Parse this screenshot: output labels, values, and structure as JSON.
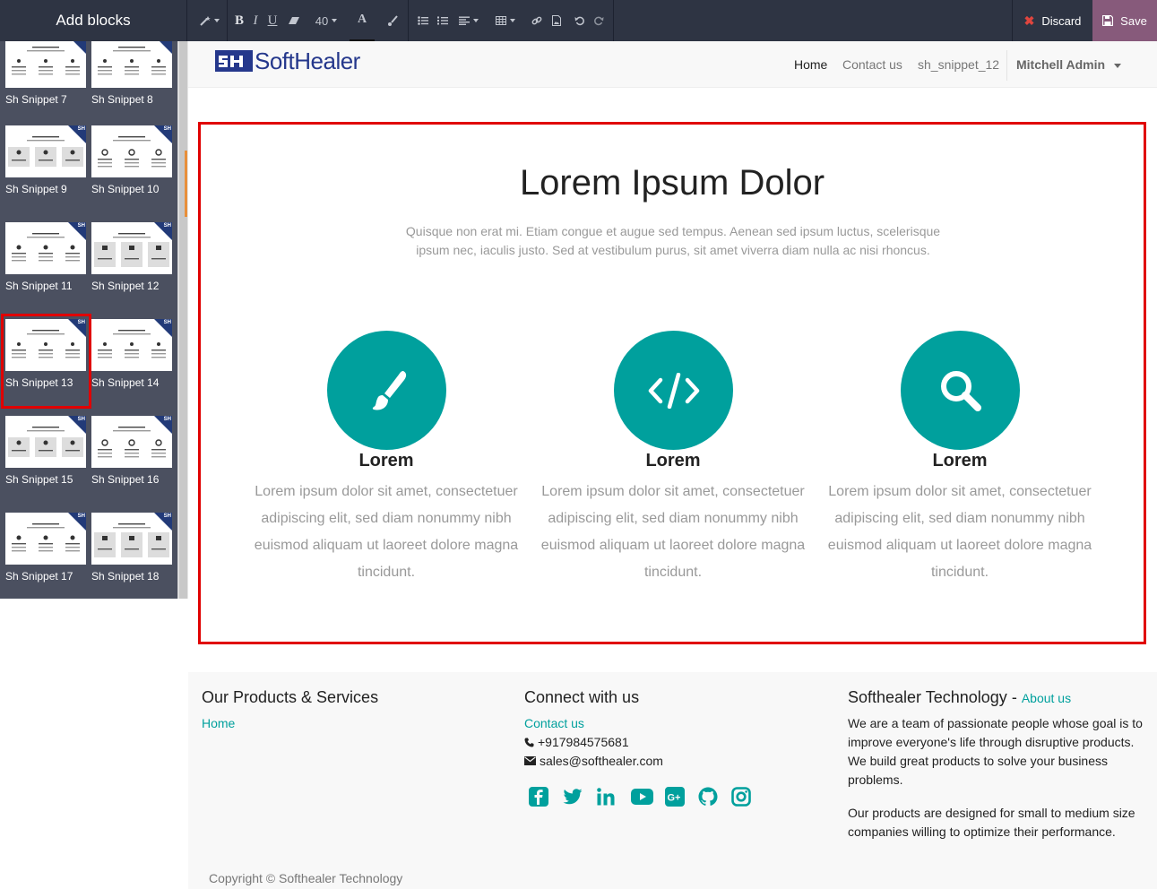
{
  "panel": {
    "title": "Add blocks",
    "snippets": [
      {
        "label": "Sh Snippet 7"
      },
      {
        "label": "Sh Snippet 8"
      },
      {
        "label": "Sh Snippet 9"
      },
      {
        "label": "Sh Snippet 10"
      },
      {
        "label": "Sh Snippet 11"
      },
      {
        "label": "Sh Snippet 12"
      },
      {
        "label": "Sh Snippet 13"
      },
      {
        "label": "Sh Snippet 14"
      },
      {
        "label": "Sh Snippet 15"
      },
      {
        "label": "Sh Snippet 16"
      },
      {
        "label": "Sh Snippet 17"
      },
      {
        "label": "Sh Snippet 18"
      }
    ],
    "selected_snippet": "Sh Snippet 13",
    "badge_text": "SH"
  },
  "toolbar": {
    "font_size": "40",
    "discard_label": "Discard",
    "save_label": "Save",
    "icons": [
      "magic-wand-icon",
      "bold-icon",
      "italic-icon",
      "underline-icon",
      "eraser-icon",
      "font-size-select",
      "font-color-icon",
      "paint-brush-icon",
      "unordered-list-icon",
      "ordered-list-icon",
      "align-icon",
      "table-icon",
      "link-icon",
      "image-icon",
      "undo-icon",
      "redo-icon"
    ]
  },
  "header": {
    "logo_text": "SoftHealer",
    "nav": [
      {
        "label": "Home"
      },
      {
        "label": "Contact us"
      },
      {
        "label": "sh_snippet_12"
      }
    ],
    "user": "Mitchell Admin"
  },
  "section": {
    "title": "Lorem Ipsum Dolor",
    "subtitle": "Quisque non erat mi. Etiam congue et augue sed tempus. Aenean sed ipsum luctus, scelerisque ipsum nec, iaculis justo. Sed at vestibulum purus, sit amet viverra diam nulla ac nisi rhoncus.",
    "features": [
      {
        "icon": "paint-brush-icon",
        "title": "Lorem",
        "text": "Lorem ipsum dolor sit amet, consectetuer adipiscing elit, sed diam nonummy nibh euismod aliquam ut laoreet dolore magna tincidunt."
      },
      {
        "icon": "code-icon",
        "title": "Lorem",
        "text": "Lorem ipsum dolor sit amet, consectetuer adipiscing elit, sed diam nonummy nibh euismod aliquam ut laoreet dolore magna tincidunt."
      },
      {
        "icon": "search-icon",
        "title": "Lorem",
        "text": "Lorem ipsum dolor sit amet, consectetuer adipiscing elit, sed diam nonummy nibh euismod aliquam ut laoreet dolore magna tincidunt."
      }
    ]
  },
  "footer": {
    "products_heading": "Our Products & Services",
    "products_link": "Home",
    "connect_heading": "Connect with us",
    "contact_link": "Contact us",
    "phone": "+917984575681",
    "email": "sales@softhealer.com",
    "social_icons": [
      "facebook-icon",
      "twitter-icon",
      "linkedin-icon",
      "youtube-icon",
      "google-plus-icon",
      "github-icon",
      "instagram-icon"
    ],
    "company_heading": "Softhealer Technology",
    "company_dash": "-",
    "about_link": "About us",
    "about_p1": "We are a team of passionate people whose goal is to improve everyone's life through disruptive products. We build great products to solve your business problems.",
    "about_p2": "Our products are designed for small to medium size companies willing to optimize their performance.",
    "copyright": "Copyright © Softhealer Technology"
  },
  "colors": {
    "toolbar_bg": "#2e3443",
    "panel_bg": "#4b5060",
    "accent_teal": "#00a09d",
    "save_purple": "#875a7b",
    "highlight_red": "#e00000",
    "logo_blue": "#25388c"
  }
}
